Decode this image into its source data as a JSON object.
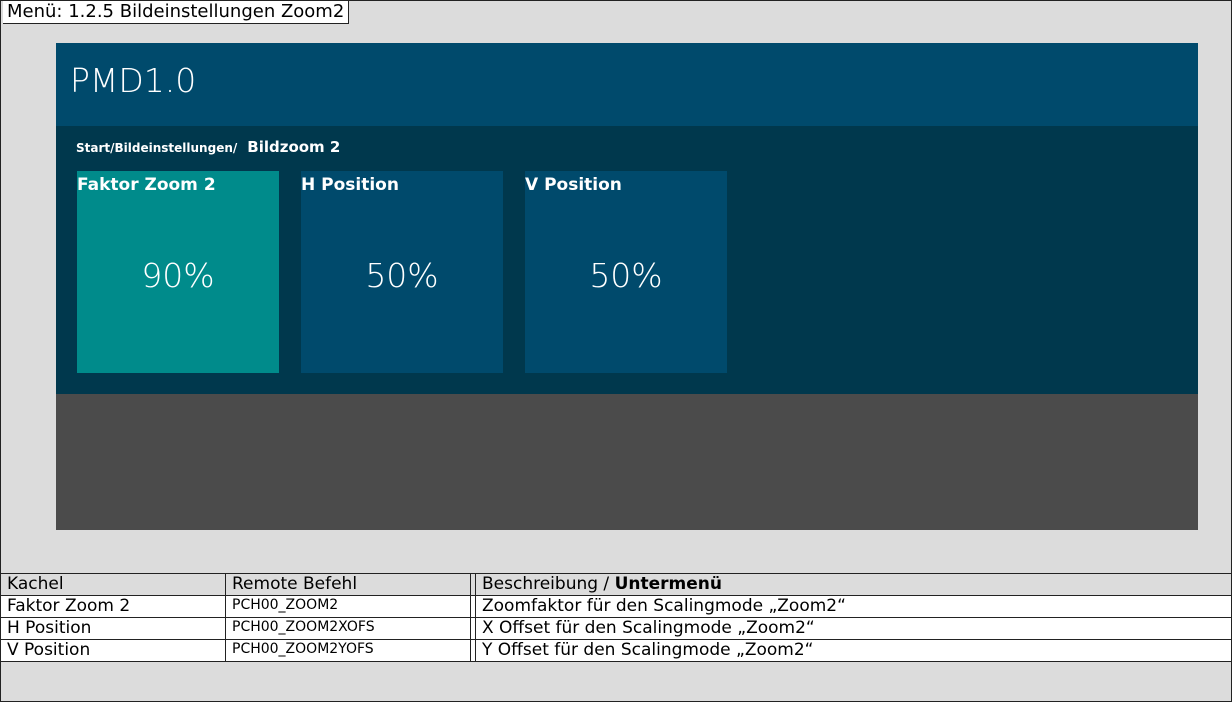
{
  "menu": {
    "title": "Menü: 1.2.5 Bildeinstellungen  Zoom2"
  },
  "app": {
    "title": "PMD1.0"
  },
  "breadcrumb": {
    "path": "Start/Bildeinstellungen/",
    "current": "Bildzoom 2"
  },
  "tiles": [
    {
      "label": "Faktor Zoom 2",
      "value": "90%",
      "active": true
    },
    {
      "label": "H Position",
      "value": "50%",
      "active": false
    },
    {
      "label": "V Position",
      "value": "50%",
      "active": false
    }
  ],
  "table": {
    "headers": [
      "Kachel",
      "Remote Befehl",
      "Beschreibung / ",
      "Untermenü"
    ],
    "rows": [
      [
        "Faktor Zoom 2",
        "PCH00_ZOOM2",
        "Zoomfaktor für den Scalingmode „Zoom2“"
      ],
      [
        "H Position",
        "PCH00_ZOOM2XOFS",
        "X Offset für den Scalingmode „Zoom2“"
      ],
      [
        "V Position",
        "PCH00_ZOOM2YOFS",
        "Y Offset für den Scalingmode „Zoom2“"
      ]
    ]
  },
  "colors": {
    "header": "#004a6c",
    "content": "#00384d",
    "active_tile": "#008b8b",
    "tile": "#004a6c",
    "footer": "#4b4b4b"
  }
}
